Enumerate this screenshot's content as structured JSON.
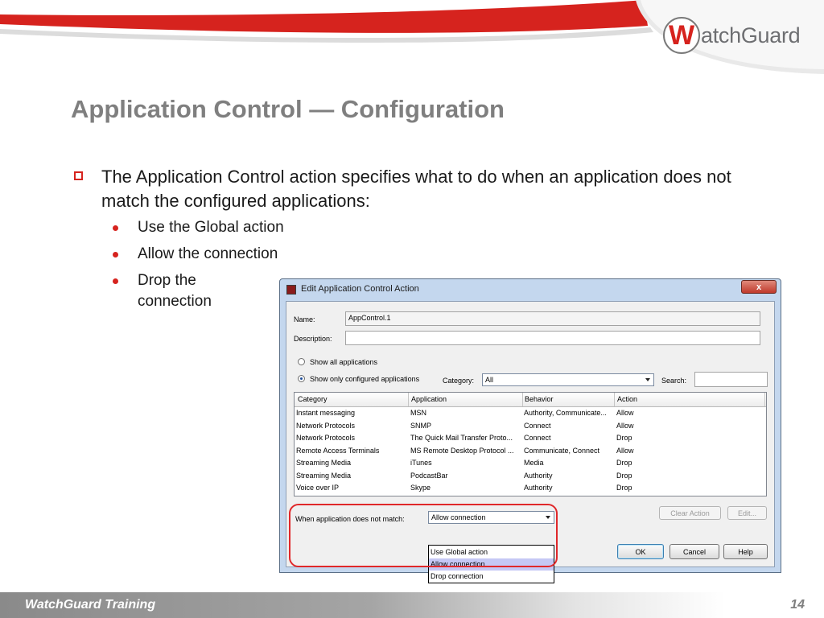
{
  "brand": {
    "logo_letter": "W",
    "logo_text": "atchGuard",
    "accent": "#d6231e"
  },
  "slide": {
    "title": "Application Control — Configuration",
    "bullet": "The Application Control action specifies what to do when an application does not match the configured applications:",
    "sub_bullets": [
      "Use the Global action",
      "Allow the connection",
      "Drop the connection"
    ]
  },
  "footer": {
    "left": "WatchGuard Training",
    "page_number": "14"
  },
  "dialog": {
    "title": "Edit Application Control Action",
    "close_glyph": "x",
    "name_label": "Name:",
    "name_value": "AppControl.1",
    "description_label": "Description:",
    "description_value": "",
    "radio_all_label": "Show all applications",
    "radio_configured_label": "Show only configured applications",
    "category_label": "Category:",
    "category_value": "All",
    "search_label": "Search:",
    "search_value": "",
    "columns": [
      "Category",
      "Application",
      "Behavior",
      "Action"
    ],
    "rows": [
      [
        "Instant messaging",
        "MSN",
        "Authority, Communicate...",
        "Allow"
      ],
      [
        "Network Protocols",
        "SNMP",
        "Connect",
        "Allow"
      ],
      [
        "Network Protocols",
        "The Quick Mail Transfer Proto...",
        "Connect",
        "Drop"
      ],
      [
        "Remote Access Terminals",
        "MS Remote Desktop Protocol ...",
        "Communicate, Connect",
        "Allow"
      ],
      [
        "Streaming Media",
        "iTunes",
        "Media",
        "Drop"
      ],
      [
        "Streaming Media",
        "PodcastBar",
        "Authority",
        "Drop"
      ],
      [
        "Voice over IP",
        "Skype",
        "Authority",
        "Drop"
      ]
    ],
    "no_match_label": "When application does not match:",
    "no_match_value": "Allow connection",
    "no_match_options": [
      "Use Global action",
      "Allow connection",
      "Drop connection"
    ],
    "selected_option_index": 1,
    "clear_action_label": "Clear Action",
    "edit_label": "Edit...",
    "ok_label": "OK",
    "cancel_label": "Cancel",
    "help_label": "Help"
  }
}
